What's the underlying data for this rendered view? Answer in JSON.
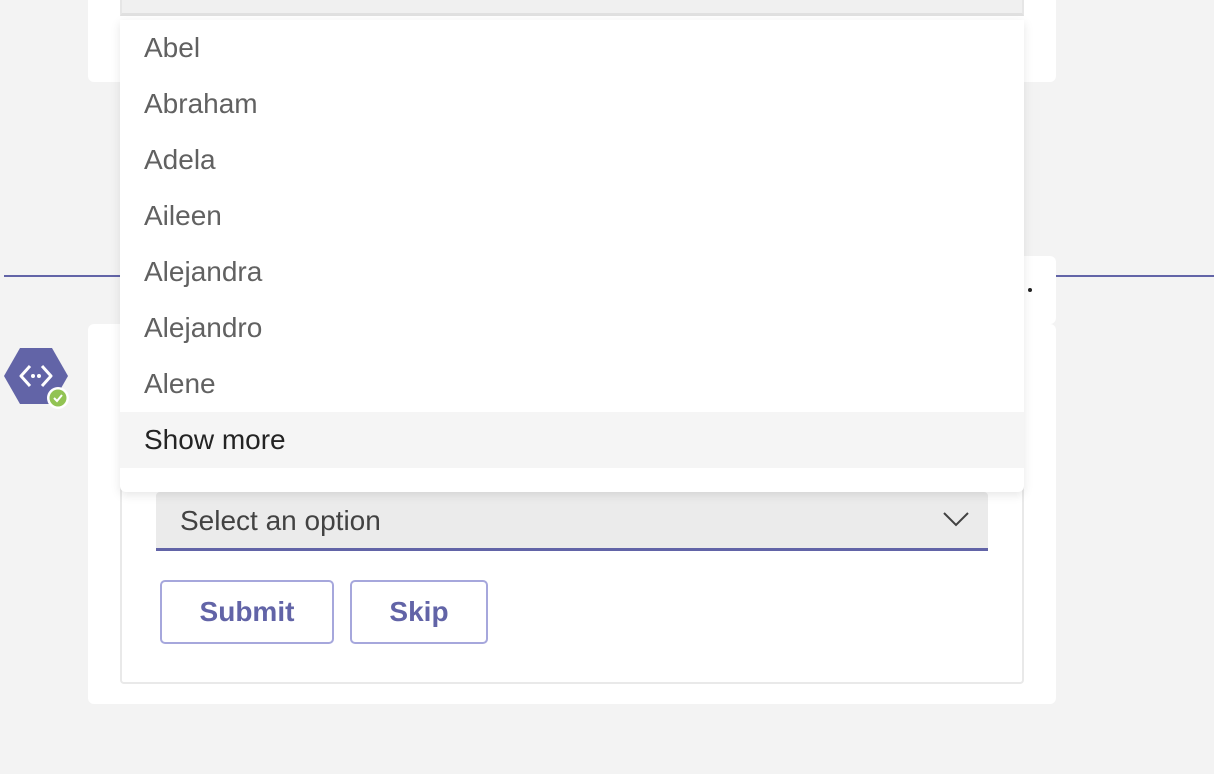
{
  "previous_card": {},
  "more_options": {
    "icon": "more-icon"
  },
  "bot": {
    "avatar_icon": "bot-hexagon-icon",
    "status_icon": "available-check-icon",
    "colors": {
      "avatar": "#6264a7",
      "status": "#92c353"
    }
  },
  "dropdown": {
    "selected_value": "Select an option",
    "chevron_icon": "chevron-down-icon",
    "options": [
      "Abel",
      "Abraham",
      "Adela",
      "Aileen",
      "Alejandra",
      "Alejandro",
      "Alene"
    ],
    "show_more_label": "Show more"
  },
  "actions": {
    "submit_label": "Submit",
    "skip_label": "Skip"
  },
  "colors": {
    "accent": "#6264a7",
    "background": "#f3f3f3",
    "card": "#ffffff"
  }
}
